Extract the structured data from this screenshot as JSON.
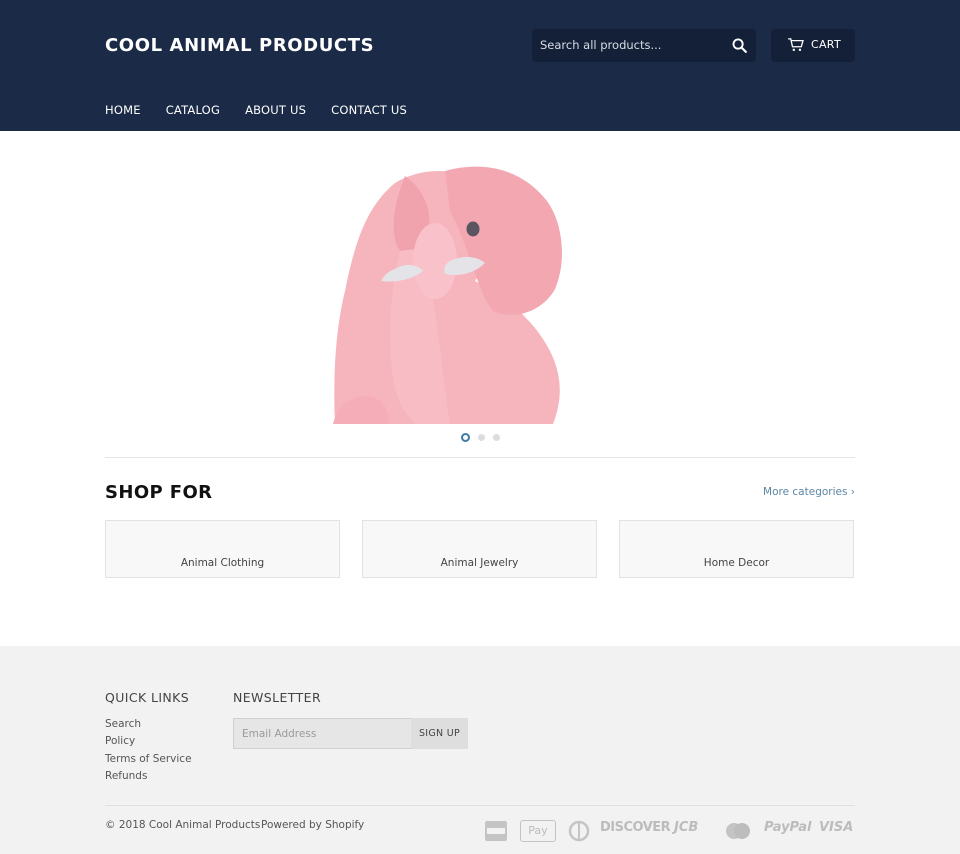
{
  "header": {
    "logo": "COOL ANIMAL PRODUCTS",
    "search_placeholder": "Search all products...",
    "cart_label": "CART",
    "nav": [
      "HOME",
      "CATALOG",
      "ABOUT US",
      "CONTACT US"
    ]
  },
  "slideshow": {
    "slide_count": 3,
    "active_slide": 1
  },
  "shop_for": {
    "title": "SHOP FOR",
    "more_link": "More categories ›",
    "categories": [
      "Animal Clothing",
      "Animal Jewelry",
      "Home Decor"
    ]
  },
  "footer": {
    "quick_links_title": "QUICK LINKS",
    "quick_links": [
      "Search",
      "Policy",
      "Terms of Service",
      "Refunds"
    ],
    "newsletter_title": "NEWSLETTER",
    "email_placeholder": "Email Address",
    "signup_label": "SIGN UP",
    "copyright": "© 2018 Cool Animal Products",
    "powered": "Powered by Shopify",
    "payment_icons": [
      "american-express-icon",
      "apple-pay-icon",
      "diners-club-icon",
      "discover-icon",
      "jcb-icon",
      "mastercard-icon",
      "paypal-icon",
      "visa-icon"
    ],
    "payment_labels": [
      "Pay",
      "DISCOVER",
      "JCB",
      "PayPal",
      "VISA"
    ]
  },
  "colors": {
    "header_bg": "#1b2b47",
    "link": "#5c86a5",
    "footer_bg": "#f2f2f2",
    "elephant": "#f6b4bd"
  }
}
